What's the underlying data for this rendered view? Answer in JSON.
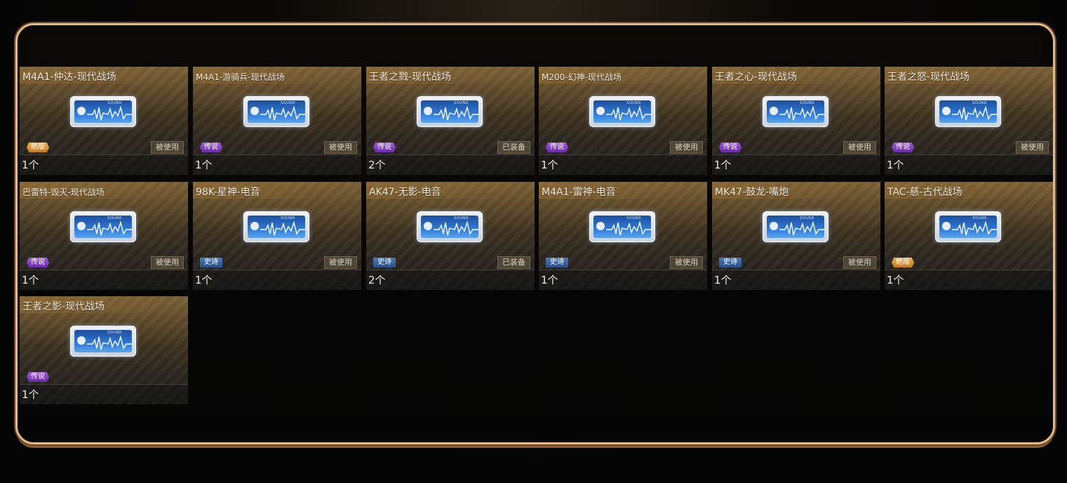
{
  "items": [
    {
      "title": "M4A1-仲达-现代战场",
      "rarity": "绝版",
      "rarity_type": "ultimate",
      "status": "被使用",
      "count": "1个"
    },
    {
      "title": "M4A1-游骑兵-现代战场",
      "rarity": "传说",
      "rarity_type": "legend",
      "status": "被使用",
      "count": "1个"
    },
    {
      "title": "王者之戮-现代战场",
      "rarity": "传说",
      "rarity_type": "legend",
      "status": "已装备",
      "count": "2个"
    },
    {
      "title": "M200-幻神-现代战场",
      "rarity": "传说",
      "rarity_type": "legend",
      "status": "被使用",
      "count": "1个"
    },
    {
      "title": "王者之心-现代战场",
      "rarity": "传说",
      "rarity_type": "legend",
      "status": "被使用",
      "count": "1个"
    },
    {
      "title": "王者之怒-现代战场",
      "rarity": "传说",
      "rarity_type": "legend",
      "status": "被使用",
      "count": "1个"
    },
    {
      "title": "巴雷特-毁灭-现代战场",
      "rarity": "传说",
      "rarity_type": "legend",
      "status": "被使用",
      "count": "1个"
    },
    {
      "title": "98K-星神-电音",
      "rarity": "史诗",
      "rarity_type": "epic",
      "status": "被使用",
      "count": "1个"
    },
    {
      "title": "AK47-无影-电音",
      "rarity": "史诗",
      "rarity_type": "epic",
      "status": "已装备",
      "count": "2个"
    },
    {
      "title": "M4A1-雷神-电音",
      "rarity": "史诗",
      "rarity_type": "epic",
      "status": "被使用",
      "count": "1个"
    },
    {
      "title": "MK47-鼓龙-嘴炮",
      "rarity": "史诗",
      "rarity_type": "epic",
      "status": "被使用",
      "count": "1个"
    },
    {
      "title": "TAC-慈-古代战场",
      "rarity": "绝版",
      "rarity_type": "ultimate",
      "status": "",
      "count": "1个"
    },
    {
      "title": "王者之影-现代战场",
      "rarity": "传说",
      "rarity_type": "legend",
      "status": "",
      "count": "1个"
    }
  ],
  "ticket_label": "SOUND",
  "colors": {
    "frame_border": "#e8b987",
    "legend": "#8a3fd0",
    "epic": "#3a64a0",
    "ultimate": "#e0982f"
  },
  "icons": {
    "item_icon": "sound-card-icon",
    "inner_icon": "waveform-icon"
  }
}
